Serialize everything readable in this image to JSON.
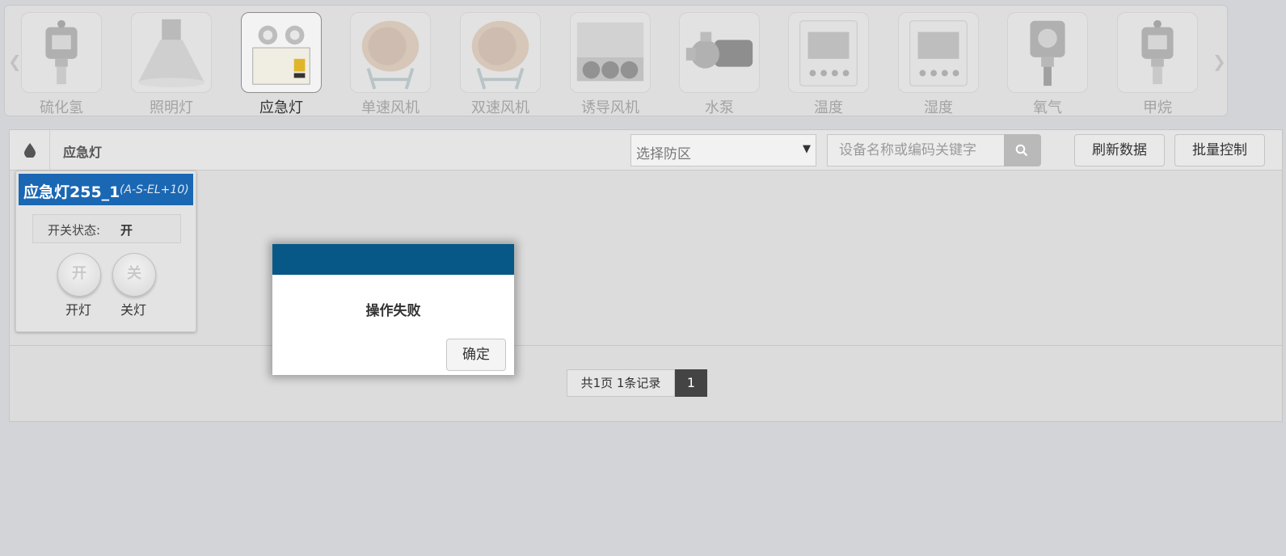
{
  "categories": [
    {
      "label": "硫化氢",
      "icon": "gas-detector-icon"
    },
    {
      "label": "照明灯",
      "icon": "high-bay-lamp-icon"
    },
    {
      "label": "应急灯",
      "icon": "emergency-light-icon",
      "active": true
    },
    {
      "label": "单速风机",
      "icon": "axial-fan-icon"
    },
    {
      "label": "双速风机",
      "icon": "axial-fan-icon"
    },
    {
      "label": "诱导风机",
      "icon": "induction-fan-icon"
    },
    {
      "label": "水泵",
      "icon": "water-pump-icon"
    },
    {
      "label": "温度",
      "icon": "thermo-meter-icon"
    },
    {
      "label": "湿度",
      "icon": "hygro-meter-icon"
    },
    {
      "label": "氧气",
      "icon": "oxygen-sensor-icon"
    },
    {
      "label": "甲烷",
      "icon": "gas-detector-icon"
    }
  ],
  "toolbar": {
    "title": "应急灯",
    "zone_select": "选择防区",
    "search_placeholder": "设备名称或编码关键字",
    "refresh_label": "刷新数据",
    "batch_label": "批量控制"
  },
  "device": {
    "name": "应急灯255_1",
    "code": "(A-S-EL+10)",
    "status_key": "开关状态:",
    "status_value": "开",
    "on_glyph": "开",
    "off_glyph": "关",
    "on_label": "开灯",
    "off_label": "关灯"
  },
  "pagination": {
    "info": "共1页 1条记录",
    "current_page": "1"
  },
  "dialog": {
    "message": "操作失败",
    "ok_label": "确定"
  },
  "colors": {
    "card_header": "#1a67b3",
    "dialog_header": "#075887",
    "active_page": "#444444"
  }
}
